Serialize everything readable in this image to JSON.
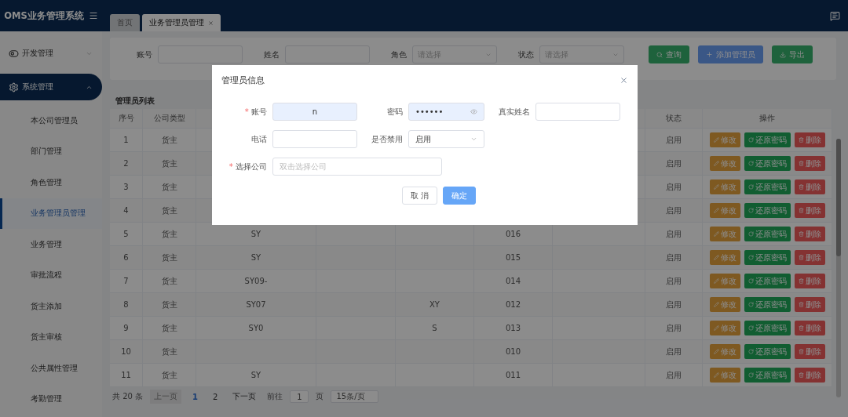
{
  "app": {
    "title": "OMS业务管理系统"
  },
  "tabs": [
    {
      "label": "首页",
      "selected": false,
      "closable": false
    },
    {
      "label": "业务管理员管理",
      "selected": true,
      "closable": true
    }
  ],
  "sidebar": [
    {
      "label": "开发管理",
      "kind": "toggle",
      "expanded": false
    },
    {
      "label": "系统管理",
      "kind": "gear",
      "expanded": true,
      "children": [
        {
          "label": "本公司管理员",
          "selected": false
        },
        {
          "label": "部门管理",
          "selected": false
        },
        {
          "label": "角色管理",
          "selected": false
        },
        {
          "label": "业务管理员管理",
          "selected": true
        },
        {
          "label": "业务管理",
          "selected": false
        },
        {
          "label": "审批流程",
          "selected": false
        },
        {
          "label": "货主添加",
          "selected": false
        },
        {
          "label": "货主审核",
          "selected": false
        },
        {
          "label": "公共属性管理",
          "selected": false
        },
        {
          "label": "考勤管理",
          "selected": false
        }
      ]
    }
  ],
  "filters": [
    {
      "label": "账号",
      "kind": "input"
    },
    {
      "label": "姓名",
      "kind": "input"
    },
    {
      "label": "角色",
      "kind": "select",
      "placeholder": "请选择"
    },
    {
      "label": "状态",
      "kind": "select",
      "placeholder": "请选择"
    }
  ],
  "filter_buttons": [
    {
      "label": "查询",
      "kind": "search"
    },
    {
      "label": "添加管理员",
      "kind": "add"
    },
    {
      "label": "导出",
      "kind": "export"
    }
  ],
  "table": {
    "title": "管理员列表",
    "columns": [
      "序号",
      "公司类型",
      "状态",
      "操作"
    ],
    "rows": [
      {
        "index": "1",
        "company_type": "货主",
        "status": "启用",
        "actions": [
          {
            "label": "修改",
            "kind": "edit"
          },
          {
            "label": "还原密码",
            "kind": "reset"
          },
          {
            "label": "删除",
            "kind": "delete"
          }
        ]
      },
      {
        "index": "2",
        "company_type": "货主",
        "status": "启用",
        "actions": [
          {
            "label": "修改",
            "kind": "edit"
          },
          {
            "label": "还原密码",
            "kind": "reset"
          },
          {
            "label": "删除",
            "kind": "delete"
          }
        ]
      },
      {
        "index": "3",
        "company_type": "货主",
        "status": "启用",
        "actions": [
          {
            "label": "修改",
            "kind": "edit"
          },
          {
            "label": "还原密码",
            "kind": "reset"
          },
          {
            "label": "删除",
            "kind": "delete"
          }
        ]
      },
      {
        "index": "4",
        "company_type": "货主",
        "status": "启用",
        "actions": [
          {
            "label": "修改",
            "kind": "edit"
          },
          {
            "label": "还原密码",
            "kind": "reset"
          },
          {
            "label": "删除",
            "kind": "delete"
          }
        ]
      },
      {
        "index": "5",
        "company_type": "货主",
        "col_3": "SY",
        "col_6": "016",
        "status": "启用",
        "actions": [
          {
            "label": "修改",
            "kind": "edit"
          },
          {
            "label": "还原密码",
            "kind": "reset"
          },
          {
            "label": "删除",
            "kind": "delete"
          }
        ]
      },
      {
        "index": "6",
        "company_type": "货主",
        "col_3": "SY",
        "col_6": "015",
        "status": "启用",
        "actions": [
          {
            "label": "修改",
            "kind": "edit"
          },
          {
            "label": "还原密码",
            "kind": "reset"
          },
          {
            "label": "删除",
            "kind": "delete"
          }
        ]
      },
      {
        "index": "7",
        "company_type": "货主",
        "col_3": "SY09-",
        "col_6": "014",
        "status": "启用",
        "actions": [
          {
            "label": "修改",
            "kind": "edit"
          },
          {
            "label": "还原密码",
            "kind": "reset"
          },
          {
            "label": "删除",
            "kind": "delete"
          }
        ]
      },
      {
        "index": "8",
        "company_type": "货主",
        "col_3": "SY07",
        "col_5": "XY",
        "col_6": "012",
        "status": "启用",
        "actions": [
          {
            "label": "修改",
            "kind": "edit"
          },
          {
            "label": "还原密码",
            "kind": "reset"
          },
          {
            "label": "删除",
            "kind": "delete"
          }
        ]
      },
      {
        "index": "9",
        "company_type": "货主",
        "col_3": "SY0",
        "col_5": "S",
        "col_6": "013",
        "status": "启用",
        "actions": [
          {
            "label": "修改",
            "kind": "edit"
          },
          {
            "label": "还原密码",
            "kind": "reset"
          },
          {
            "label": "删除",
            "kind": "delete"
          }
        ]
      },
      {
        "index": "10",
        "company_type": "货主",
        "col_6": "010",
        "status": "启用",
        "actions": [
          {
            "label": "修改",
            "kind": "edit"
          },
          {
            "label": "还原密码",
            "kind": "reset"
          },
          {
            "label": "删除",
            "kind": "delete"
          }
        ]
      },
      {
        "index": "11",
        "company_type": "货主",
        "col_3": "SY",
        "col_6": "011",
        "status": "启用",
        "actions": [
          {
            "label": "修改",
            "kind": "edit"
          },
          {
            "label": "还原密码",
            "kind": "reset"
          },
          {
            "label": "删除",
            "kind": "delete"
          }
        ]
      }
    ]
  },
  "pagination": {
    "total": "共 20 条",
    "prev": {
      "label": "上一页",
      "disabled": true
    },
    "pages": [
      {
        "label": "1",
        "selected": true
      },
      {
        "label": "2",
        "selected": false
      }
    ],
    "next": {
      "label": "下一页",
      "disabled": false
    },
    "goto_label": "前往",
    "goto_value": "1",
    "page_unit": "页",
    "page_size": "15条/页"
  },
  "dialog": {
    "title": "管理员信息",
    "fields": [
      {
        "label": "账号",
        "kind": "input",
        "required": true,
        "required_mark": "*",
        "value": "n",
        "autofilled": true
      },
      {
        "label": "密码",
        "kind": "password",
        "value": "••••••",
        "autofilled": true
      },
      {
        "label": "真实姓名",
        "kind": "input",
        "autofilled": false
      },
      {
        "label": "电话",
        "kind": "input",
        "autofilled": false
      },
      {
        "label": "是否禁用",
        "kind": "select",
        "value": "启用"
      },
      {
        "label": "选择公司",
        "kind": "wide",
        "required": true,
        "required_mark": "*",
        "placeholder": "双击选择公司"
      }
    ],
    "buttons": [
      {
        "label": "取 消",
        "kind": "default"
      },
      {
        "label": "确定",
        "kind": "primary"
      }
    ]
  }
}
